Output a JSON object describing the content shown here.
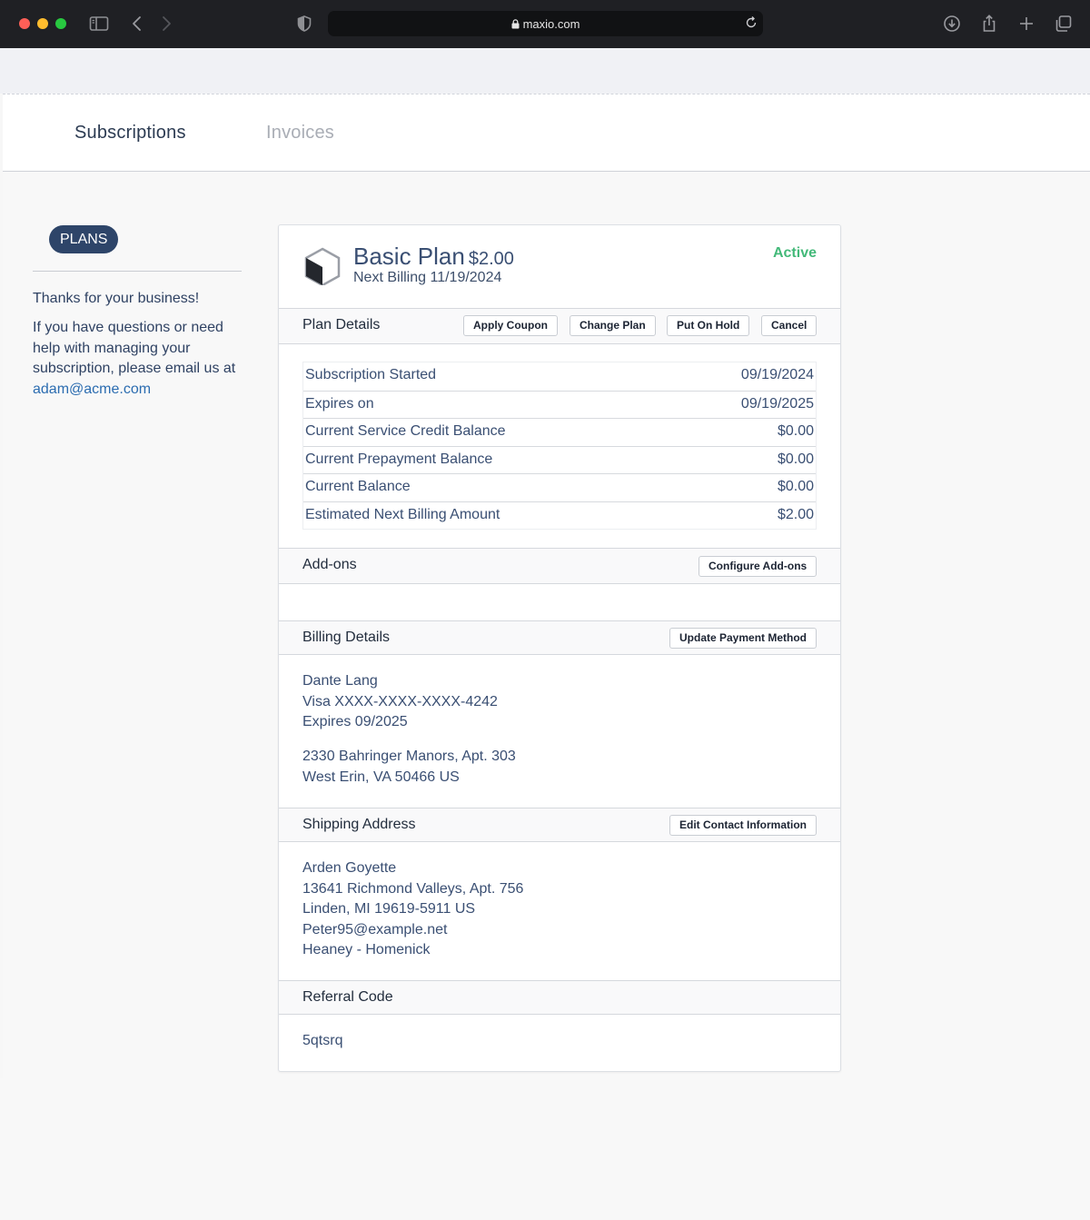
{
  "browser": {
    "url": "maxio.com"
  },
  "tabs": [
    {
      "label": "Subscriptions"
    },
    {
      "label": "Invoices"
    }
  ],
  "sidebar": {
    "plans_label": "PLANS",
    "thanks": "Thanks for your business!",
    "help_text": "If you have questions or need help with managing your subscription, please email us at",
    "email": "adam@acme.com"
  },
  "plan": {
    "name": "Basic Plan",
    "price": "$2.00",
    "next_billing_label": "Next Billing",
    "next_billing_date": "11/19/2024",
    "status": "Active",
    "status_color": "#43b979"
  },
  "plan_details": {
    "title": "Plan Details",
    "buttons": {
      "apply_coupon": "Apply Coupon",
      "change_plan": "Change Plan",
      "put_on_hold": "Put On Hold",
      "cancel": "Cancel"
    },
    "rows": [
      {
        "label": "Subscription Started",
        "value": "09/19/2024"
      },
      {
        "label": "Expires on",
        "value": "09/19/2025"
      },
      {
        "label": "Current Service Credit Balance",
        "value": "$0.00"
      },
      {
        "label": "Current Prepayment Balance",
        "value": "$0.00"
      },
      {
        "label": "Current Balance",
        "value": "$0.00"
      },
      {
        "label": "Estimated Next Billing Amount",
        "value": "$2.00"
      }
    ]
  },
  "addons": {
    "title": "Add-ons",
    "button": "Configure Add-ons"
  },
  "billing": {
    "title": "Billing Details",
    "button": "Update Payment Method",
    "name": "Dante Lang",
    "card": "Visa XXXX-XXXX-XXXX-4242",
    "expires": "Expires 09/2025",
    "address1": "2330 Bahringer Manors, Apt. 303",
    "address2": "West Erin, VA 50466 US"
  },
  "shipping": {
    "title": "Shipping Address",
    "button": "Edit Contact Information",
    "name": "Arden Goyette",
    "address1": "13641 Richmond Valleys, Apt. 756",
    "address2": "Linden, MI 19619-5911 US",
    "email": "Peter95@example.net",
    "company": "Heaney - Homenick"
  },
  "referral": {
    "title": "Referral Code",
    "code": "5qtsrq"
  },
  "colors": {
    "accent": "#2e4569",
    "link": "#2b6cb0",
    "text": "#3a4f73"
  }
}
